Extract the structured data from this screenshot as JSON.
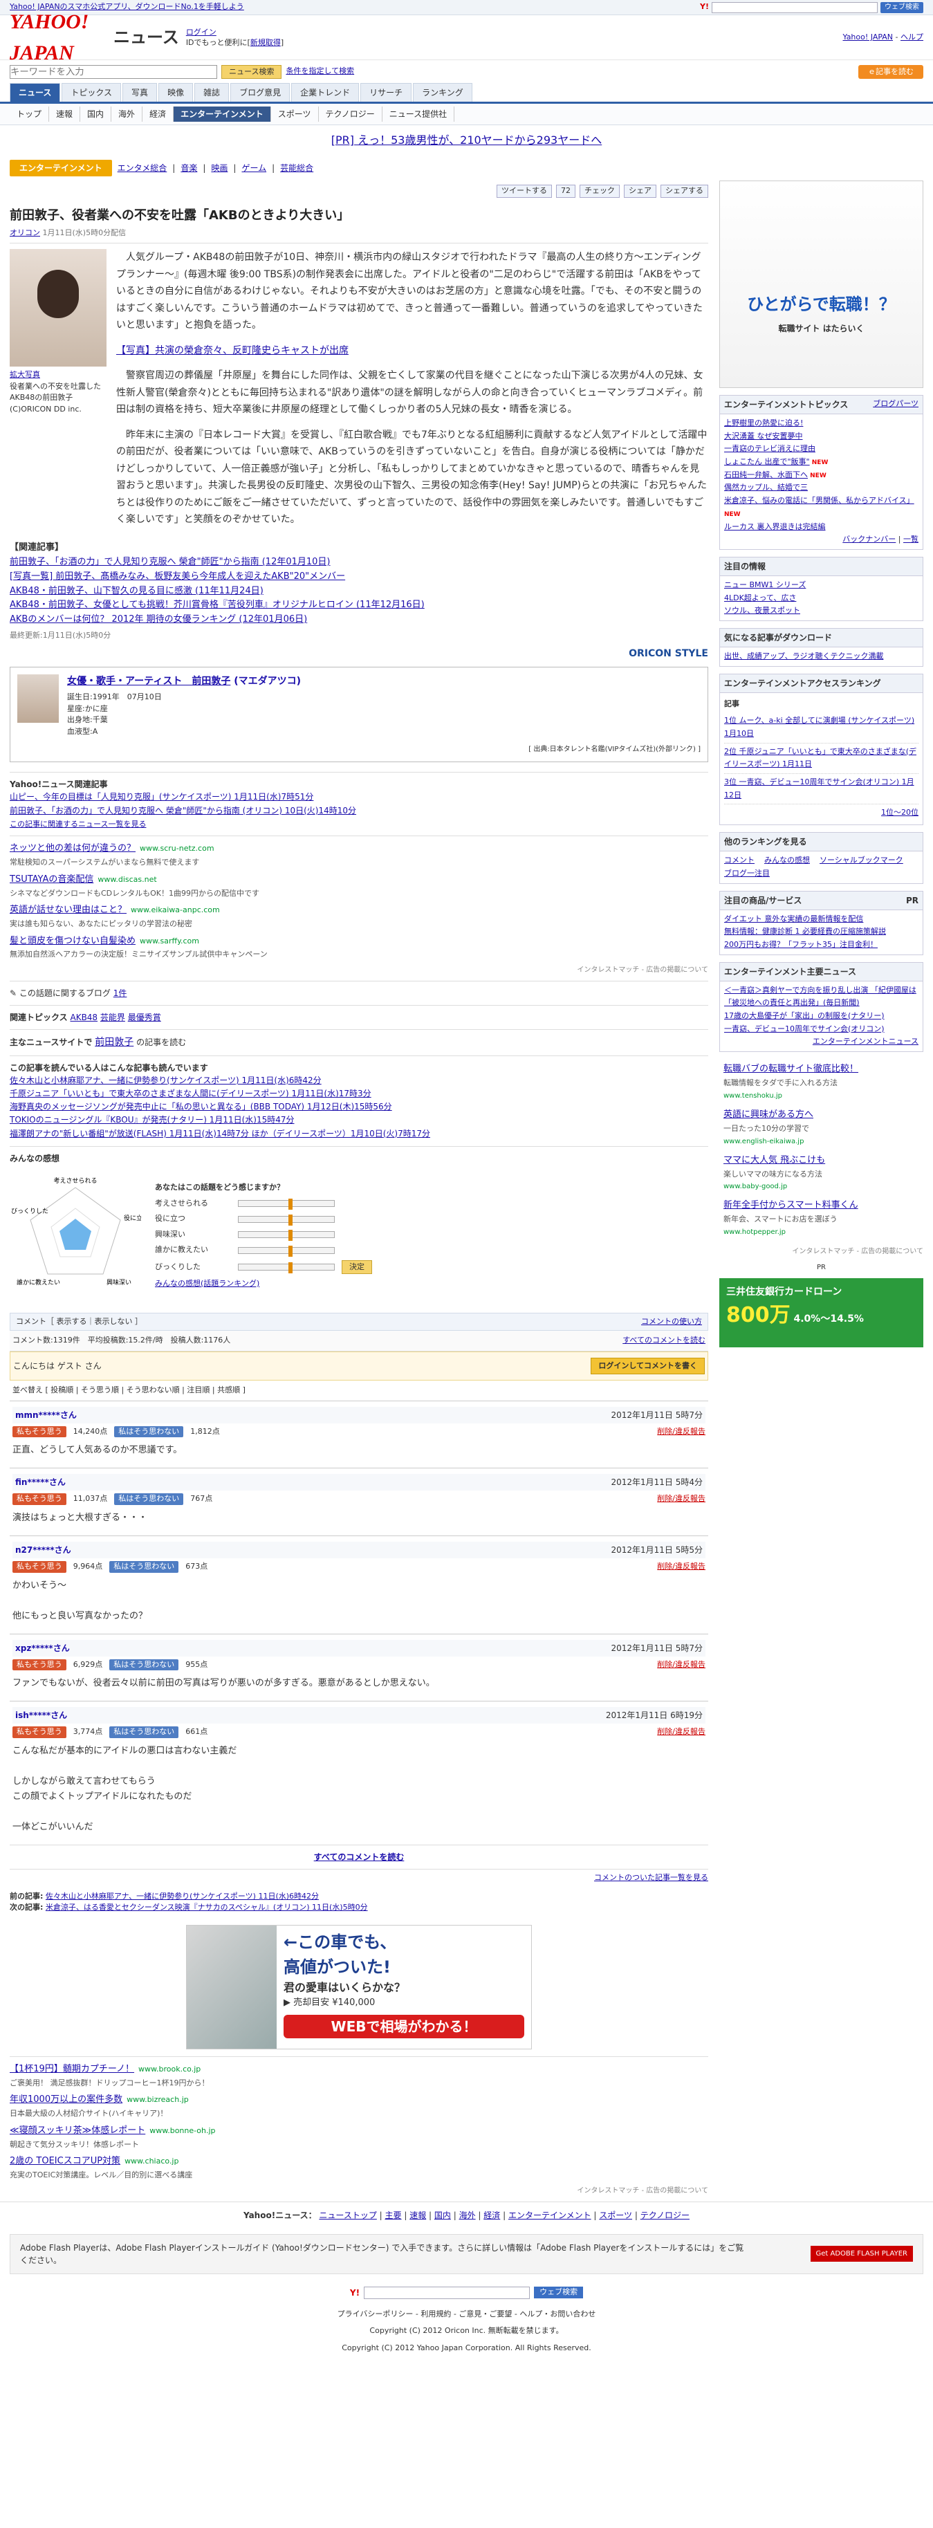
{
  "topbar": {
    "promo": "Yahoo! JAPANのスマホ公式アプリ、ダウンロードNo.1を手軽しよう",
    "search_button": "ウェブ検索"
  },
  "header": {
    "logo": "YAHOO! JAPAN",
    "section": "ニュース",
    "login": "ログイン",
    "login_note": "IDでもっと便利に[",
    "register": "新規取得",
    "right_links": [
      "Yahoo! JAPAN",
      "ヘルプ"
    ]
  },
  "search": {
    "placeholder": "キーワードを入力",
    "button": "ニュース検索",
    "advanced": "条件を指定して検索",
    "orange_button": "ｅ記事を読む"
  },
  "nav1": [
    "ニュース",
    "トピックス",
    "写真",
    "映像",
    "雑誌",
    "ブログ意見",
    "企業トレンド",
    "リサーチ",
    "ランキング"
  ],
  "nav2": [
    "トップ",
    "速報",
    "国内",
    "海外",
    "経済",
    "エンターテインメント",
    "スポーツ",
    "テクノロジー",
    "ニュース提供社"
  ],
  "pr_line": "[PR] えっ！53歳男性が、210ヤードから293ヤードへ",
  "category": {
    "tag": "エンターテインメント",
    "links": [
      "エンタメ総合",
      "音楽",
      "映画",
      "ゲーム",
      "芸能総合"
    ]
  },
  "share": {
    "tweet": "ツイートする",
    "count": "72",
    "check": "チェック",
    "share": "シェア",
    "mixi": "シェアする"
  },
  "article": {
    "title": "前田敦子、役者業への不安を吐露「AKBのときより大きい」",
    "source": "オリコン",
    "date": " 1月11日(水)5時0分配信",
    "photo_link": "拡大写真",
    "photo_caption": "役者業への不安を吐露したAKB48の前田敦子 (C)ORICON DD inc.",
    "p1": "人気グループ・AKB48の前田敦子が10日、神奈川・横浜市内の緑山スタジオで行われたドラマ『最高の人生の終り方～エンディングプランナー～』(毎週木曜 後9:00 TBS系)の制作発表会に出席した。アイドルと役者の\"二足のわらじ\"で活躍する前田は「AKBをやっているときの自分に自信があるわけじゃない。それよりも不安が大きいのはお芝居の方」と意識な心境を吐露。「でも、その不安と闘うのはすごく楽しいんです。こういう普通のホームドラマは初めてで、きっと普通って一番難しい。普通っていうのを追求してやっていきたいと思います」と抱負を語った。",
    "photo_link2": "【写真】共演の榮倉奈々、反町隆史らキャストが出席",
    "p2": "警察官周辺の葬儀屋「井原屋」を舞台にした同作は、父親を亡くして家業の代目を継ぐことになった山下演じる次男が4人の兄妹、女性新人警官(榮倉奈々)とともに毎回持ち込まれる\"訳あり遺体\"の謎を解明しながら人の命と向き合っていくヒューマンラブコメディ。前田は制の資格を持ち、短大卒業後に井原屋の経理として働くしっかり者の5人兄妹の長女・晴香を演じる。",
    "p3": "昨年末に主演の『日本レコード大賞』を受賞し、『紅白歌合戦』でも7年ぶりとなる紅組勝利に貢献するなど人気アイドルとして活躍中の前田だが、役者業については「いい意味で、AKBっていうのを引きずっていないこと」を告白。自身が演じる役柄については「静かだけどしっかりしていて、人一倍正義感が強い子」と分析し、「私もしっかりしてまとめていかなきゃと思っているので、晴香ちゃんを見習おうと思います」。共演した長男役の反町隆史、次男役の山下智久、三男役の知念侑李(Hey! Say! JUMP)らとの共演に「お兄ちゃんたちとは役作りのためにご飯をご一緒させていただいて、ずっと言っていたので、話役作中の雰囲気を楽しみたいです。普通しいでもすごく楽しいです」と笑顔をのぞかせていた。",
    "related_title": "【関連記事】",
    "related": [
      "前田敦子、「お酒の力」で人見知り克服へ 榮倉\"師匠\"から指南 (12年01月10日)",
      "[写真一覧] 前田敦子、髙橋みなみ、板野友美ら今年成人を迎えたAKB\"20\"メンバー",
      "AKB48・前田敦子、山下智久の見る目に感激 (11年11月24日)",
      "AKB48・前田敦子、女優としても挑戦！芥川賞骨格『苦役列車』オリジナルヒロイン (11年12月16日)",
      "AKBのメンバーは何位？ 2012年 期待の女優ランキング (12年01月06日)"
    ],
    "updated": "最終更新:1月11日(水)5時0分",
    "oricon": "ORICON STYLE"
  },
  "profile": {
    "name": "女優・歌手・アーティスト　前田敦子",
    "kana": "(マエダアツコ)",
    "birthday": "誕生日:1991年　07月10日",
    "sign": "星座:かに座",
    "birthplace": "出身地:千葉",
    "blood": "血液型:A",
    "source": "[ 出典:日本タレント名鑑(VIPタイムズ社)(外部リンク) ]"
  },
  "yahoo_related": {
    "title": "Yahoo!ニュース関連記事",
    "items": [
      "山ピー、今年の目標は「人見知り克服」(サンケイスポーツ) 1月11日(水)7時51分",
      "前田敦子、「お酒の力」で人見知り克服へ 榮倉\"師匠\"から指南 (オリコン) 10日(火)14時10分"
    ],
    "more": "この記事に関連するニュース一覧を見る"
  },
  "ads": [
    {
      "title": "ネッツと他の差は何が違うの？",
      "url": "www.scru-netz.com",
      "desc": "常駐検知のスーパーシステムがいまなら無料で使えます"
    },
    {
      "title": "TSUTAYAの音楽配信",
      "url": "www.discas.net",
      "desc": "シネマなどダウンロードもCDレンタルもOK！1曲99円からの配信中です"
    },
    {
      "title": "英語が話せない理由はこと？",
      "url": "www.eikaiwa-anpc.com",
      "desc": "実は誰も知らない、あなたにピッタリの学習法の秘密"
    },
    {
      "title": "髪と頭皮を傷つけない自髪染め",
      "url": "www.sarffy.com",
      "desc": "無添加自然派ヘアカラーの決定版！ミニサイズサンプル試供中キャンペーン"
    }
  ],
  "interest_match": "インタレストマッチ - 広告の掲載について",
  "blog": {
    "label": "この話題に関するブログ",
    "count": "1件"
  },
  "topics": {
    "label": "関連トピックス",
    "items": [
      "AKB48",
      "芸能界",
      "最優秀賞"
    ]
  },
  "main_person": {
    "label": "主なニュースサイトで",
    "name": "前田敦子",
    "suffix": "の記事を読む"
  },
  "also_read": {
    "title": "この記事を読んでいる人はこんな記事も読んでいます",
    "items": [
      "佐々木山と小林麻耶アナ、一緒に伊勢参り(サンケイスポーツ) 1月11日(水)6時42分",
      "千原ジュニア「いいとも」で東大卒のさまざまな人間に(デイリースポーツ) 1月11日(水)17時3分",
      "海野真央のメッセージソングが発売中止に「私の思いと異なる」(BBB TODAY) 1月12日(木)15時56分",
      "TOKIOのニュージングル『KBOU』が発売(ナタリー) 1月11日(水)15時47分",
      "福澤朗アナの\"新しい番組\"が放送(FLASH) 1月11日(水)14時7分 ほか（デイリースポーツ）1月10日(火)7時17分"
    ]
  },
  "survey": {
    "title": "みんなの感想",
    "question": "あなたはこの話題をどう感じますか？",
    "axes": [
      "考えさせられる",
      "役に立つ",
      "興味深い",
      "誰かに教えたい",
      "びっくりした"
    ],
    "submit": "決定",
    "result_link": "みんなの感想(話題ランキング)"
  },
  "comments_bar": {
    "left": "コメント［ 表示する｜表示しない ］",
    "right": "コメントの使い方"
  },
  "comment_stats": {
    "text": "コメント数:1319件　平均投稿数:15.2件/時　投稿人数:1176人",
    "all_link": "すべてのコメントを読む"
  },
  "guest": {
    "text": "こんにちは ゲスト さん",
    "button": "ログインしてコメントを書く"
  },
  "sort": "並べ替え [ 投稿順 | そう思う順 | そう思わない順 | 注目順 | 共感順 ]",
  "vote_labels": {
    "agree": "私もそう思う",
    "disagree": "私はそう思わない",
    "report": "削除/違反報告"
  },
  "comments": [
    {
      "user": "mmn*****さん",
      "date": "2012年1月11日 5時7分",
      "agree": "14,240点",
      "disagree": "1,812点",
      "body": "正直、どうして人気あるのか不思議です。"
    },
    {
      "user": "fin*****さん",
      "date": "2012年1月11日 5時4分",
      "agree": "11,037点",
      "disagree": "767点",
      "body": "演技はちょっと大根すぎる・・・"
    },
    {
      "user": "n27*****さん",
      "date": "2012年1月11日 5時5分",
      "agree": "9,964点",
      "disagree": "673点",
      "body": "かわいそう～\n\n他にもっと良い写真なかったの？"
    },
    {
      "user": "xpz*****さん",
      "date": "2012年1月11日 5時7分",
      "agree": "6,929点",
      "disagree": "955点",
      "body": "ファンでもないが、役者云々以前に前田の写真は写りが悪いのが多すぎる。悪意があるとしか思えない。"
    },
    {
      "user": "ish*****さん",
      "date": "2012年1月11日 6時19分",
      "agree": "3,774点",
      "disagree": "661点",
      "body": "こんな私だが基本的にアイドルの悪口は言わない主義だ\n\nしかしながら敢えて言わせてもらう\nこの顔でよくトップアイドルになれたものだ\n\n一体どこがいいんだ"
    }
  ],
  "all_comments_link": "すべてのコメントを読む",
  "comments_link2": "コメントのついた記事一覧を見る",
  "prev_next": {
    "prev_label": "前の記事:",
    "prev": "佐々木山と小林麻耶アナ、一緒に伊勢参り(サンケイスポーツ) 11日(水)6時42分",
    "next_label": "次の記事:",
    "next": "米倉涼子、はる香愛とセクシーダンス映演『ナサカのスペシャル』(オリコン) 11日(水)5時0分"
  },
  "car_ad": {
    "line1": "←この車でも、",
    "line2": "高値がついた!",
    "line3": "君の愛車はいくらかな？",
    "line4": "▶ 売却目安 ¥140,000",
    "cta": "WEBで相場がわかる！"
  },
  "ads2": [
    {
      "title": "【1杯19円】髄期カプチーノ！",
      "url": "www.brook.co.jp",
      "desc": "ご褒美用！ 満足感抜群！ドリップコーヒー1杯19円から！"
    },
    {
      "title": "年収1000万以上の案件多数",
      "url": "www.bizreach.jp",
      "desc": "日本最大級の人材紹介サイト(ハイキャリア)！"
    },
    {
      "title": "≪寝顔スッキリ茶≫体感レポート",
      "url": "www.bonne-oh.jp",
      "desc": "朝起きて気分スッキリ！体感レポート"
    },
    {
      "title": "2歳の TOEICスコアUP対策",
      "url": "www.chiaco.jp",
      "desc": "充実のTOEIC対策講座。レベル／目的別に選べる講座"
    }
  ],
  "footer": {
    "nav_label": "Yahoo!ニュース：",
    "nav": [
      "ニューストップ",
      "主要",
      "速報",
      "国内",
      "海外",
      "経済",
      "エンターテインメント",
      "スポーツ",
      "テクノロジー"
    ],
    "flash_text": "Adobe Flash Playerは、Adobe Flash Playerインストールガイド (Yahoo!ダウンロードセンター) で入手できます。さらに詳しい情報は「Adobe Flash Playerをインストールするには」をご覧ください。",
    "flash_badge": "Get ADOBE FLASH PLAYER",
    "search_button": "ウェブ検索",
    "links": "プライバシーポリシー - 利用規約 - ご意見・ご要望 - ヘルプ・お問い合わせ",
    "copyright1": "Copyright (C) 2012 Oricon Inc. 無断転載を禁じます。",
    "copyright2": "Copyright (C) 2012 Yahoo Japan Corporation. All Rights Reserved."
  },
  "side": {
    "ad_headline": "ひとがらで転職！？",
    "ad_brand": "転職サイト はたらいく",
    "topics_title": "エンターテインメントトピックス",
    "topics_more": "ブログパーツ",
    "topics": [
      "上野樹里の熱愛に迫る!",
      "大沢湧蓋 なぜ安置夢中",
      "一青窈のテレビ消えに理由",
      "しょこたん 出産で\"飯事\"",
      "石田純一弁解、水面下ヘ",
      "偶然カップル、結婚で三",
      "米倉凉子、悩みの電話に「男関係、私からアドバイス」",
      "ルーカス 裏入界退きは完結編"
    ],
    "backnumber": "バックナンバー",
    "list": "一覧",
    "attention_title": "注目の情報",
    "attention": [
      "ニュー BMW1 シリーズ",
      "4LDK超よって、広さ",
      "ソウル、夜景スポット"
    ],
    "download_title": "気になる記事がダウンロード",
    "download": "出世、成績アップ、ラジオ聴くテクニック満載",
    "ranking_title": "エンターテインメントアクセスランキング",
    "ranking_label": "記事",
    "ranking": [
      "1位 ムーク、a-ki 全部してに演劇場 (サンケイスポーツ) 1月10日",
      "2位 千原ジュニア「いいとも」で東大卒のさまざまな(デイリースポーツ) 1月11日",
      "3位 一青窈、デビュー10周年でサイン会(オリコン) 1月12日"
    ],
    "ranking_more": "1位〜20位",
    "other_rank_title": "他のランキングを見る",
    "other_rank": [
      "コメント",
      "みんなの感想",
      "ソーシャルブックマーク",
      "ブログ一注目"
    ],
    "notice_title": "注目の商品/サービス",
    "notice": [
      "ダイエット 意外な実績の最新情報を配信",
      "無料情報：健康診断 1 必要経費の圧縮施策解説",
      "200万円もお得？「フラット35」注目金利！"
    ],
    "main_news_title": "エンターテインメント主要ニュース",
    "main_news": [
      "＜一青窈＞真剣ヤーで方向を振り乱し出演 「紀伊國屋は「被災地への責任と再出発」(毎日新聞)",
      "17歳の大島優子が「家出」の制服を(ナタリー)",
      "一青窈、デビュー10周年でサイン会(オリコン)"
    ],
    "main_news_more": "エンターテインメントニュース",
    "side_ads": [
      {
        "t": "転職バブの転職サイト徹底比較！",
        "d": "転職情報をタダで手に入れる方法",
        "u": "www.tenshoku.jp"
      },
      {
        "t": "英語に興味がある方へ",
        "d": "一日たった10分の学習で",
        "u": "www.english-eikaiwa.jp"
      },
      {
        "t": "ママに大人気 飛ぶこけも",
        "d": "楽しいママの味方になる方法",
        "u": "www.baby-good.jp"
      },
      {
        "t": "新年全手付からスマート料事くん",
        "d": "新年会、スマートにお店を選ぼう",
        "u": "www.hotpepper.jp"
      }
    ],
    "interest_match": "インタレストマッチ - 広告の掲載について",
    "pr": "PR",
    "bank_brand": "三井住友銀行カードローン",
    "bank_amount": "800万",
    "bank_rate": "4.0%〜14.5%"
  }
}
